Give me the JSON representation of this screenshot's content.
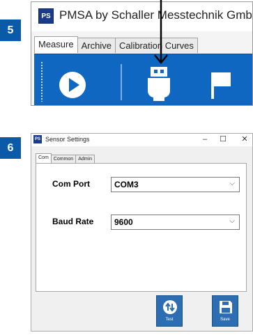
{
  "steps": {
    "first": "5",
    "second": "6"
  },
  "main_window": {
    "logo_text": "PS",
    "title": "PMSA by Schaller Messtechnik GmbH",
    "tabs": [
      {
        "label": "Measure",
        "active": true
      },
      {
        "label": "Archive",
        "active": false
      },
      {
        "label": "Calibration Curves",
        "active": false
      }
    ],
    "toolbar": {
      "color": "#1067c2",
      "icons": [
        "play-icon",
        "usb-connector-icon",
        "flag-icon"
      ]
    }
  },
  "settings_dialog": {
    "logo_text": "PS",
    "title": "Sensor Settings",
    "window_controls": {
      "minimize": "–",
      "maximize": "☐",
      "close": "✕"
    },
    "tabs": [
      {
        "label": "Com",
        "active": true
      },
      {
        "label": "Common",
        "active": false
      },
      {
        "label": "Admin",
        "active": false
      }
    ],
    "fields": {
      "com_port": {
        "label": "Com Port",
        "value": "COM3"
      },
      "baud_rate": {
        "label": "Baud Rate",
        "value": "9600"
      }
    },
    "dropdown_arrow": "⌵",
    "buttons": {
      "test": {
        "label": "Test",
        "icon": "swap-arrows-icon"
      },
      "save": {
        "label": "Save",
        "icon": "floppy-disk-icon"
      }
    }
  },
  "colors": {
    "step_badge": "#0a5aa8",
    "toolbar_blue": "#1067c2",
    "button_blue": "#2d6eb3"
  }
}
